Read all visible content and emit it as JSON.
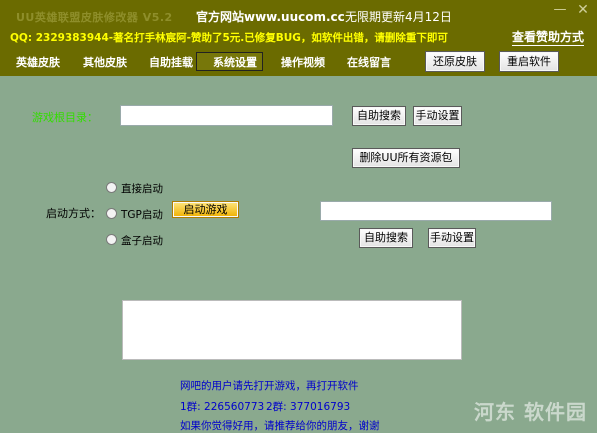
{
  "window": {
    "title": "UU英雄联盟皮肤修改器 V5.2",
    "site_link": "官方网站www.uucom.cc",
    "date_label": "无限期更新4月12日",
    "minimize_icon": "minimize-icon",
    "close_icon": "close-icon"
  },
  "banner": {
    "qq_text": "QQ: 2329383944-著名打手林宸阿-赞助了5元.已修复BUG，如软件出错，请删除重下即可",
    "donate_link": "查看赞助方式"
  },
  "nav": {
    "items": [
      {
        "label": "英雄皮肤"
      },
      {
        "label": "其他皮肤"
      },
      {
        "label": "自助挂载"
      },
      {
        "label": "系统设置"
      },
      {
        "label": "操作视频"
      },
      {
        "label": "在线留言"
      }
    ],
    "active": "系统设置",
    "restore_skin": "还原皮肤",
    "restart_software": "重启软件"
  },
  "main": {
    "game_dir_label": "游戏根目录：",
    "game_dir_value": "",
    "auto_search": "自助搜索",
    "manual_set": "手动设置",
    "delete_resources": "删除UU所有资源包",
    "launch_label": "启动方式：",
    "launch_options": [
      {
        "label": "直接启动"
      },
      {
        "label": "TGP启动"
      },
      {
        "label": "盒子启动"
      }
    ],
    "start_game": "启动游戏",
    "launch_path_value": "",
    "auto_search_2": "自助搜索",
    "manual_set_2": "手动设置",
    "log_text": ""
  },
  "notes": {
    "line1": "网吧的用户请先打开游戏，再打开软件",
    "group1": "1群: 226560773",
    "group2": "2群: 377016793",
    "line3": "如果你觉得好用，请推荐给你的朋友，谢谢"
  },
  "watermark": "河东 软件园",
  "colors": {
    "header_bg": "#6b6b00",
    "body_bg": "#8aa98e",
    "qq_text": "#ffff00",
    "game_dir_label": "#33dd00",
    "note_text": "#0000cc",
    "start_button": "#f0b000"
  }
}
